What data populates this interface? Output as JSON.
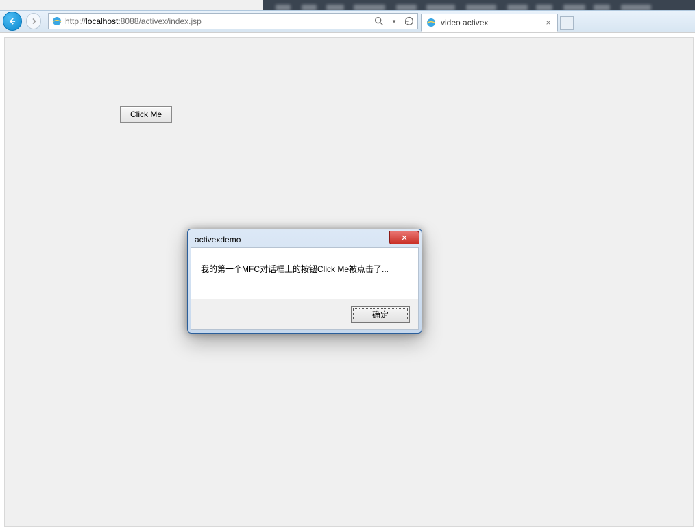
{
  "address": {
    "protocol": "http://",
    "host": "localhost",
    "port": ":8088",
    "path": "/activex/index.jsp",
    "search_icon": "search-icon",
    "dropdown_icon": "chevron-down-icon",
    "refresh_icon": "refresh-icon"
  },
  "tab": {
    "title": "video activex",
    "close_label": "×"
  },
  "page": {
    "click_me_label": "Click Me"
  },
  "dialog": {
    "title": "activexdemo",
    "message": "我的第一个MFC对话框上的按钮Click Me被点击了...",
    "ok_label": "确定"
  }
}
